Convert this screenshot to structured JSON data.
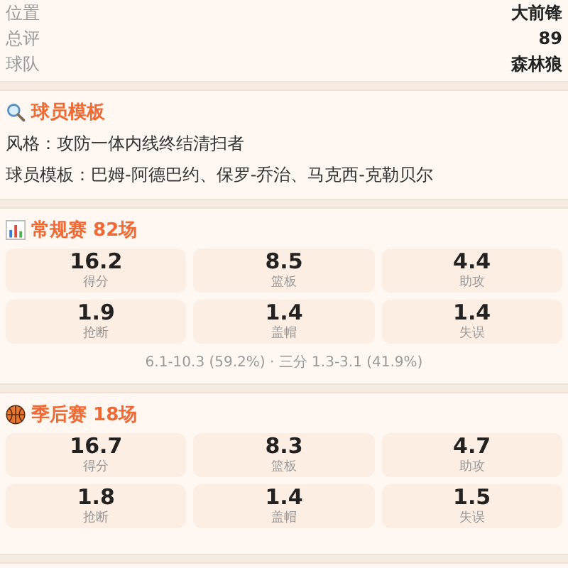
{
  "info_rows": [
    {
      "label": "位置",
      "value": "大前锋"
    },
    {
      "label": "总评",
      "value": "89"
    },
    {
      "label": "球队",
      "value": "森林狼"
    }
  ],
  "template": {
    "title": "球员模板",
    "lines": [
      "风格：攻防一体内线终结清扫者",
      "球员模板：巴姆-阿德巴约、保罗-乔治、马克西-克勒贝尔"
    ]
  },
  "stat_sections": [
    {
      "kind": "regular",
      "title": "常规赛 82场",
      "stats": [
        {
          "value": "16.2",
          "label": "得分"
        },
        {
          "value": "8.5",
          "label": "篮板"
        },
        {
          "value": "4.4",
          "label": "助攻"
        },
        {
          "value": "1.9",
          "label": "抢断"
        },
        {
          "value": "1.4",
          "label": "盖帽"
        },
        {
          "value": "1.4",
          "label": "失误"
        }
      ],
      "shooting": "6.1-10.3 (59.2%) · 三分 1.3-3.1 (41.9%)"
    },
    {
      "kind": "playoffs",
      "title": "季后赛 18场",
      "stats": [
        {
          "value": "16.7",
          "label": "得分"
        },
        {
          "value": "8.3",
          "label": "篮板"
        },
        {
          "value": "4.7",
          "label": "助攻"
        },
        {
          "value": "1.8",
          "label": "抢断"
        },
        {
          "value": "1.4",
          "label": "盖帽"
        },
        {
          "value": "1.5",
          "label": "失误"
        }
      ]
    }
  ]
}
